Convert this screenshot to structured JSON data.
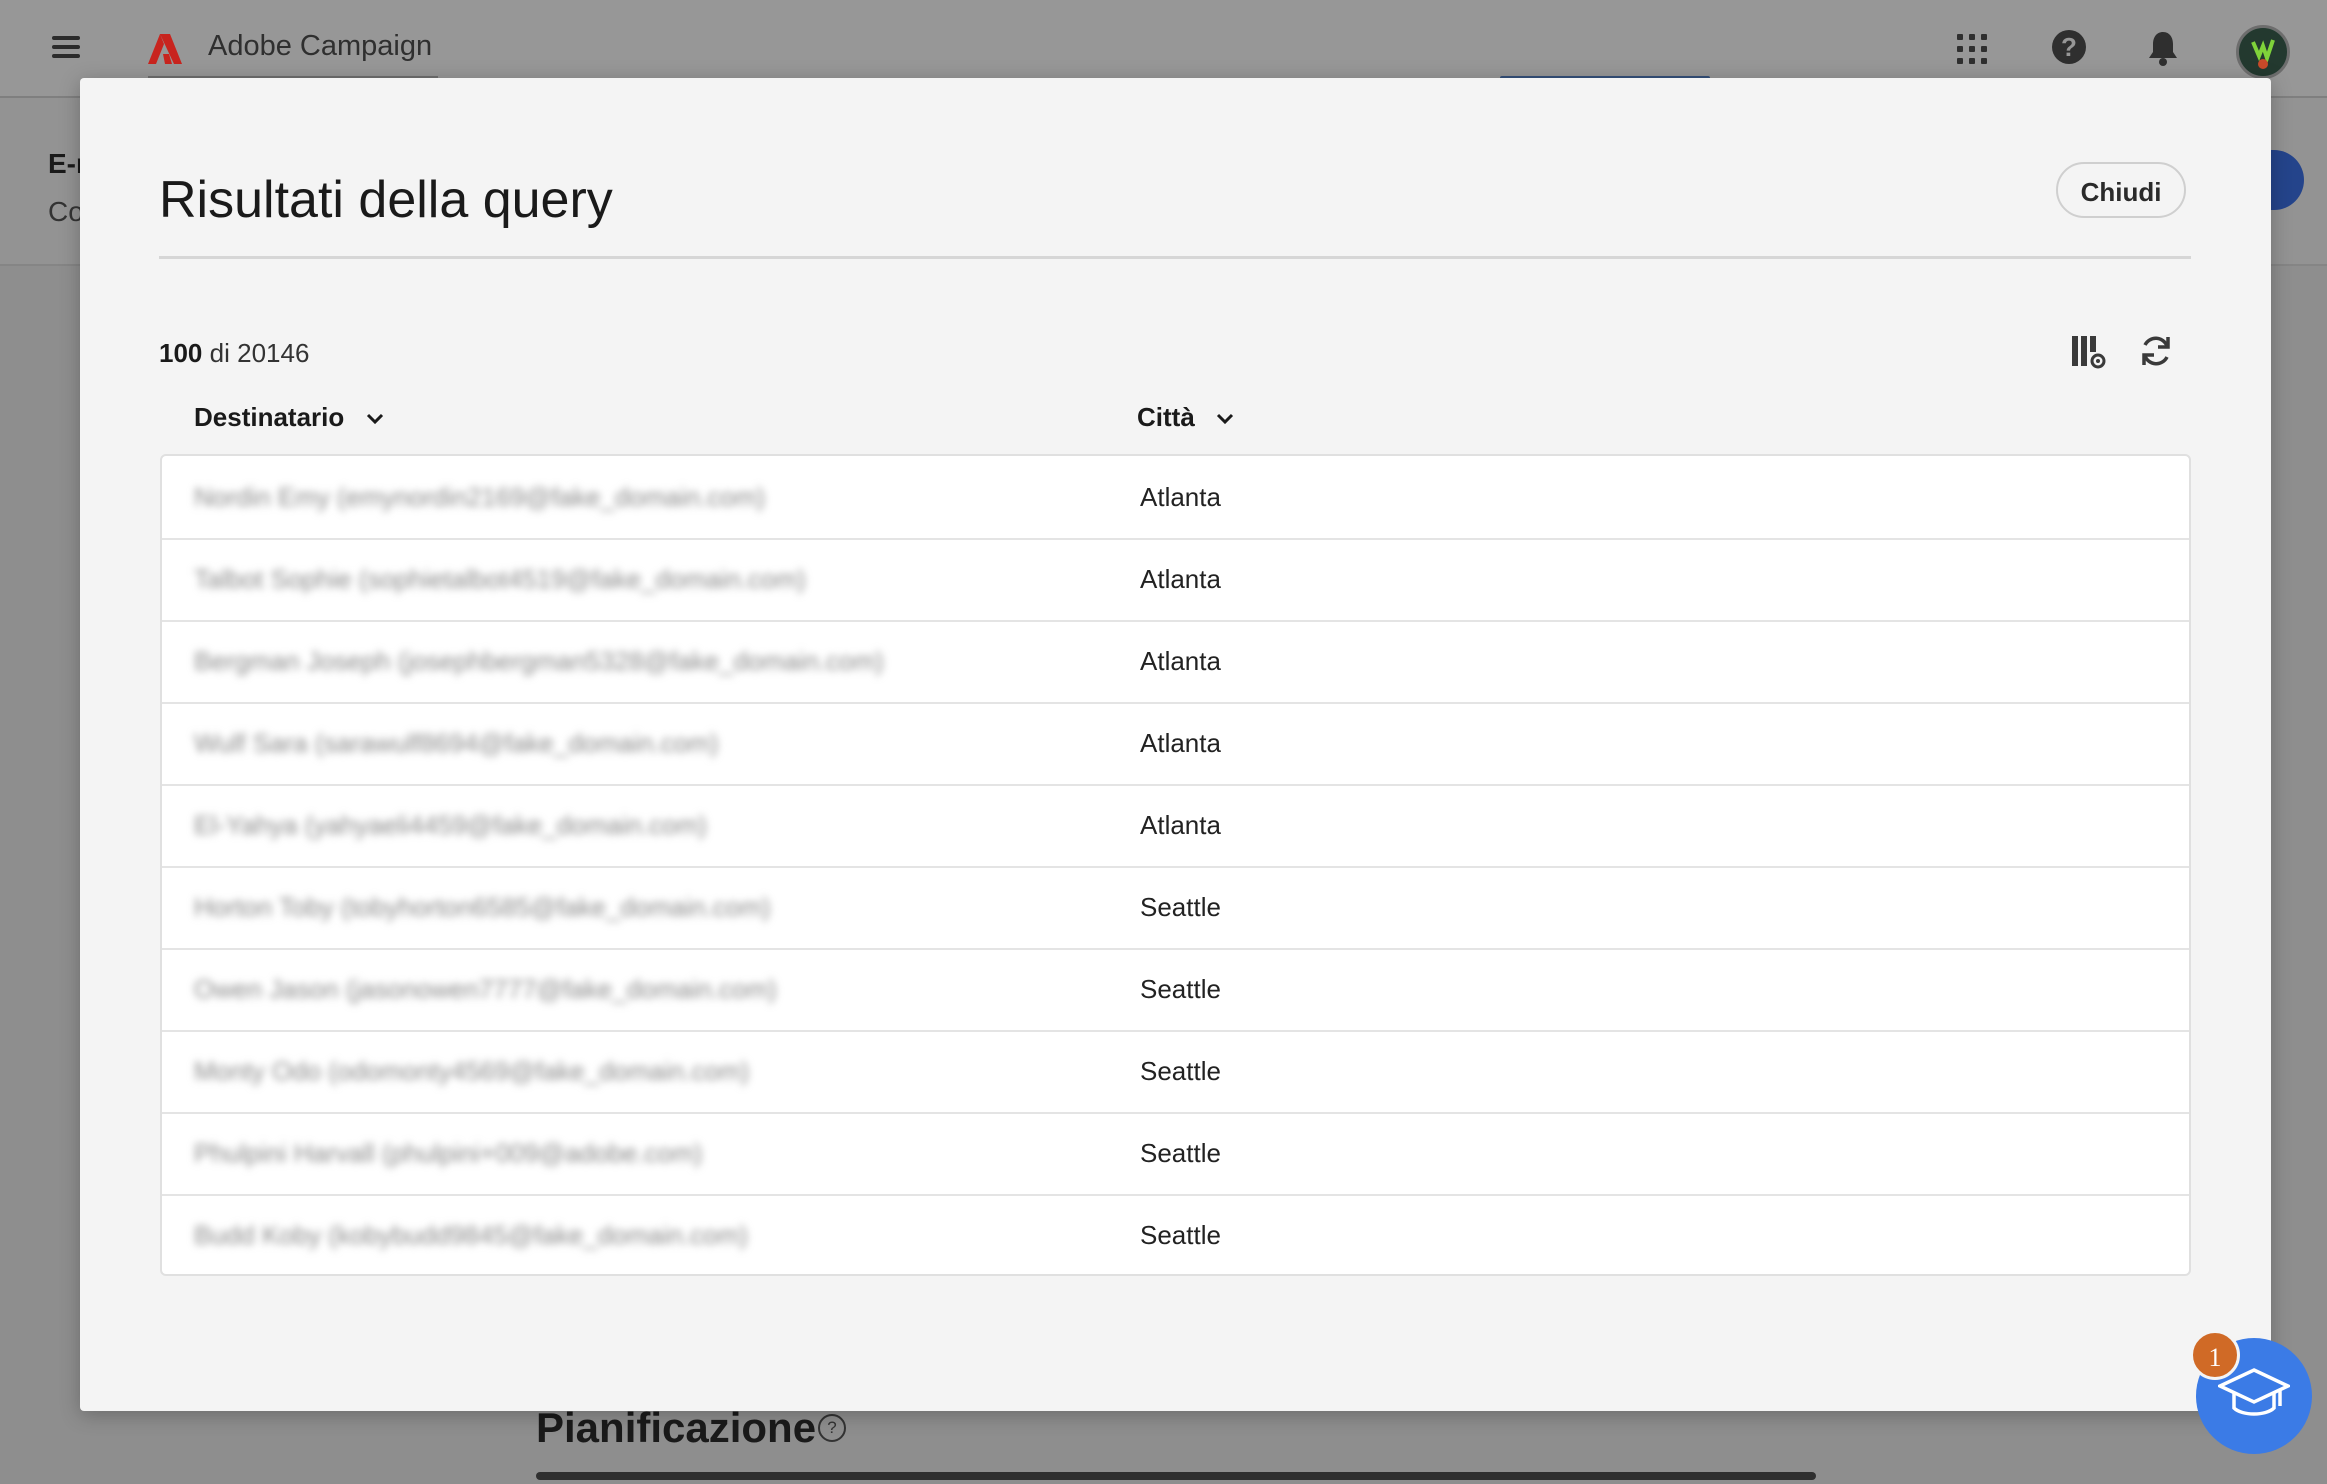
{
  "app": {
    "name": "Adobe Campaign"
  },
  "background": {
    "page_title": "E-m",
    "page_subtitle": "Co",
    "section_title": "Pianificazione"
  },
  "modal": {
    "title": "Risultati della query",
    "close_label": "Chiudi",
    "count_shown": "100",
    "count_separator": "di",
    "count_total": "20146",
    "columns": [
      {
        "label": "Destinatario"
      },
      {
        "label": "Città"
      }
    ],
    "rows": [
      {
        "recipient": "Nordin Emy (emynordin2169@fake_domain.com)",
        "city": "Atlanta"
      },
      {
        "recipient": "Talbot Sophie (sophietalbot4519@fake_domain.com)",
        "city": "Atlanta"
      },
      {
        "recipient": "Bergman Joseph (josephbergman5328@fake_domain.com)",
        "city": "Atlanta"
      },
      {
        "recipient": "Wulf Sara (sarawulf8694@fake_domain.com)",
        "city": "Atlanta"
      },
      {
        "recipient": "El-Yahya (yahyaeli4459@fake_domain.com)",
        "city": "Atlanta"
      },
      {
        "recipient": "Horton Toby (tobyhorton6585@fake_domain.com)",
        "city": "Seattle"
      },
      {
        "recipient": "Owen Jason (jasonowen7777@fake_domain.com)",
        "city": "Seattle"
      },
      {
        "recipient": "Monty Odo (odomonty4569@fake_domain.com)",
        "city": "Seattle"
      },
      {
        "recipient": "Phulpini Harvall (phulpini+009@adobe.com)",
        "city": "Seattle"
      },
      {
        "recipient": "Budd Koby (kobybudd9845@fake_domain.com)",
        "city": "Seattle"
      }
    ]
  },
  "help": {
    "badge_count": "1"
  },
  "colors": {
    "accent_blue": "#3b7be6",
    "badge_orange": "#d06a26",
    "adobe_red": "#c8241e"
  },
  "icons": [
    "hamburger-icon",
    "adobe-logo-icon",
    "apps-grid-icon",
    "help-icon",
    "bell-icon",
    "avatar",
    "column-settings-icon",
    "refresh-icon",
    "chevron-down-icon",
    "graduation-cap-icon"
  ]
}
